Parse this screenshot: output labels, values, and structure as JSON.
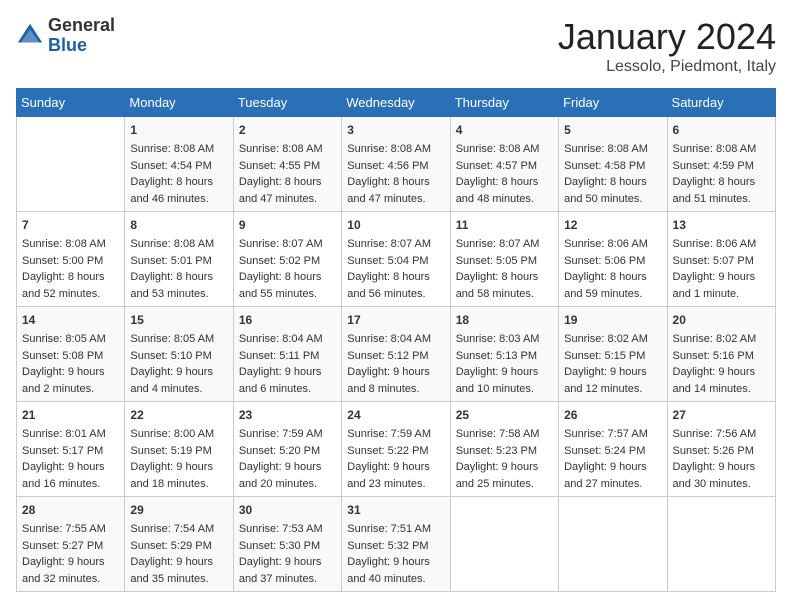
{
  "header": {
    "logo_general": "General",
    "logo_blue": "Blue",
    "month_title": "January 2024",
    "subtitle": "Lessolo, Piedmont, Italy"
  },
  "days_of_week": [
    "Sunday",
    "Monday",
    "Tuesday",
    "Wednesday",
    "Thursday",
    "Friday",
    "Saturday"
  ],
  "weeks": [
    [
      {
        "day": "",
        "info": ""
      },
      {
        "day": "1",
        "info": "Sunrise: 8:08 AM\nSunset: 4:54 PM\nDaylight: 8 hours\nand 46 minutes."
      },
      {
        "day": "2",
        "info": "Sunrise: 8:08 AM\nSunset: 4:55 PM\nDaylight: 8 hours\nand 47 minutes."
      },
      {
        "day": "3",
        "info": "Sunrise: 8:08 AM\nSunset: 4:56 PM\nDaylight: 8 hours\nand 47 minutes."
      },
      {
        "day": "4",
        "info": "Sunrise: 8:08 AM\nSunset: 4:57 PM\nDaylight: 8 hours\nand 48 minutes."
      },
      {
        "day": "5",
        "info": "Sunrise: 8:08 AM\nSunset: 4:58 PM\nDaylight: 8 hours\nand 50 minutes."
      },
      {
        "day": "6",
        "info": "Sunrise: 8:08 AM\nSunset: 4:59 PM\nDaylight: 8 hours\nand 51 minutes."
      }
    ],
    [
      {
        "day": "7",
        "info": "Sunrise: 8:08 AM\nSunset: 5:00 PM\nDaylight: 8 hours\nand 52 minutes."
      },
      {
        "day": "8",
        "info": "Sunrise: 8:08 AM\nSunset: 5:01 PM\nDaylight: 8 hours\nand 53 minutes."
      },
      {
        "day": "9",
        "info": "Sunrise: 8:07 AM\nSunset: 5:02 PM\nDaylight: 8 hours\nand 55 minutes."
      },
      {
        "day": "10",
        "info": "Sunrise: 8:07 AM\nSunset: 5:04 PM\nDaylight: 8 hours\nand 56 minutes."
      },
      {
        "day": "11",
        "info": "Sunrise: 8:07 AM\nSunset: 5:05 PM\nDaylight: 8 hours\nand 58 minutes."
      },
      {
        "day": "12",
        "info": "Sunrise: 8:06 AM\nSunset: 5:06 PM\nDaylight: 8 hours\nand 59 minutes."
      },
      {
        "day": "13",
        "info": "Sunrise: 8:06 AM\nSunset: 5:07 PM\nDaylight: 9 hours\nand 1 minute."
      }
    ],
    [
      {
        "day": "14",
        "info": "Sunrise: 8:05 AM\nSunset: 5:08 PM\nDaylight: 9 hours\nand 2 minutes."
      },
      {
        "day": "15",
        "info": "Sunrise: 8:05 AM\nSunset: 5:10 PM\nDaylight: 9 hours\nand 4 minutes."
      },
      {
        "day": "16",
        "info": "Sunrise: 8:04 AM\nSunset: 5:11 PM\nDaylight: 9 hours\nand 6 minutes."
      },
      {
        "day": "17",
        "info": "Sunrise: 8:04 AM\nSunset: 5:12 PM\nDaylight: 9 hours\nand 8 minutes."
      },
      {
        "day": "18",
        "info": "Sunrise: 8:03 AM\nSunset: 5:13 PM\nDaylight: 9 hours\nand 10 minutes."
      },
      {
        "day": "19",
        "info": "Sunrise: 8:02 AM\nSunset: 5:15 PM\nDaylight: 9 hours\nand 12 minutes."
      },
      {
        "day": "20",
        "info": "Sunrise: 8:02 AM\nSunset: 5:16 PM\nDaylight: 9 hours\nand 14 minutes."
      }
    ],
    [
      {
        "day": "21",
        "info": "Sunrise: 8:01 AM\nSunset: 5:17 PM\nDaylight: 9 hours\nand 16 minutes."
      },
      {
        "day": "22",
        "info": "Sunrise: 8:00 AM\nSunset: 5:19 PM\nDaylight: 9 hours\nand 18 minutes."
      },
      {
        "day": "23",
        "info": "Sunrise: 7:59 AM\nSunset: 5:20 PM\nDaylight: 9 hours\nand 20 minutes."
      },
      {
        "day": "24",
        "info": "Sunrise: 7:59 AM\nSunset: 5:22 PM\nDaylight: 9 hours\nand 23 minutes."
      },
      {
        "day": "25",
        "info": "Sunrise: 7:58 AM\nSunset: 5:23 PM\nDaylight: 9 hours\nand 25 minutes."
      },
      {
        "day": "26",
        "info": "Sunrise: 7:57 AM\nSunset: 5:24 PM\nDaylight: 9 hours\nand 27 minutes."
      },
      {
        "day": "27",
        "info": "Sunrise: 7:56 AM\nSunset: 5:26 PM\nDaylight: 9 hours\nand 30 minutes."
      }
    ],
    [
      {
        "day": "28",
        "info": "Sunrise: 7:55 AM\nSunset: 5:27 PM\nDaylight: 9 hours\nand 32 minutes."
      },
      {
        "day": "29",
        "info": "Sunrise: 7:54 AM\nSunset: 5:29 PM\nDaylight: 9 hours\nand 35 minutes."
      },
      {
        "day": "30",
        "info": "Sunrise: 7:53 AM\nSunset: 5:30 PM\nDaylight: 9 hours\nand 37 minutes."
      },
      {
        "day": "31",
        "info": "Sunrise: 7:51 AM\nSunset: 5:32 PM\nDaylight: 9 hours\nand 40 minutes."
      },
      {
        "day": "",
        "info": ""
      },
      {
        "day": "",
        "info": ""
      },
      {
        "day": "",
        "info": ""
      }
    ]
  ]
}
